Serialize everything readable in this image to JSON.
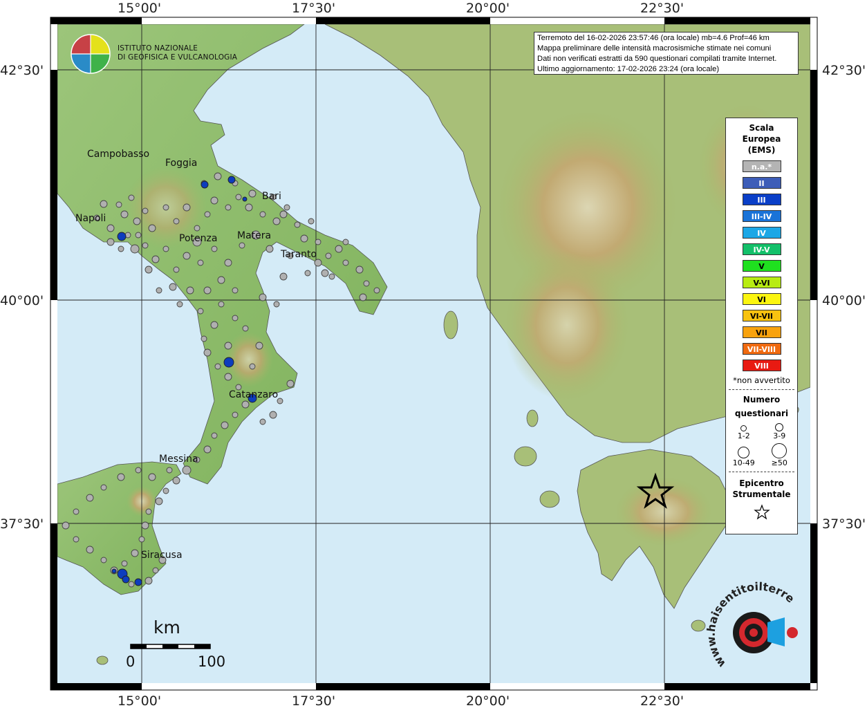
{
  "coords": {
    "top": [
      "15°00'",
      "17°30'",
      "20°00'",
      "22°30'"
    ],
    "bottom": [
      "15°00'",
      "17°30'",
      "20°00'",
      "22°30'"
    ],
    "left": [
      "42°30'",
      "40°00'",
      "37°30'"
    ],
    "right": [
      "42°30'",
      "40°00'",
      "37°30'"
    ]
  },
  "info": {
    "line1": "Terremoto del 16-02-2026 23:57:46 (ora locale) mb=4.6 Prof=46 km",
    "line2": "Mappa preliminare delle intensità macrosismiche stimate nei comuni",
    "line3": "Dati non verificati estratti da 590 questionari compilati tramite Internet.",
    "line4": "Ultimo aggiornamento: 17-02-2026 23:24 (ora locale)"
  },
  "logo": {
    "line1": "ISTITUTO NAZIONALE",
    "line2": "DI GEOFISICA E VULCANOLOGIA"
  },
  "legend": {
    "title1": "Scala",
    "title2": "Europea",
    "title3": "(EMS)",
    "ems": [
      {
        "label": "n.a.*",
        "color": "#b4b4b4"
      },
      {
        "label": "II",
        "color": "#3d5db8"
      },
      {
        "label": "III",
        "color": "#0a3fc8"
      },
      {
        "label": "III-IV",
        "color": "#1a73d8"
      },
      {
        "label": "IV",
        "color": "#1ca7e6"
      },
      {
        "label": "IV-V",
        "color": "#13c06a"
      },
      {
        "label": "V",
        "color": "#1fe01f"
      },
      {
        "label": "V-VI",
        "color": "#b8ec12"
      },
      {
        "label": "VI",
        "color": "#fbf510"
      },
      {
        "label": "VI-VII",
        "color": "#f8c210"
      },
      {
        "label": "VII",
        "color": "#f8a20e"
      },
      {
        "label": "VII-VIII",
        "color": "#f06a10"
      },
      {
        "label": "VIII",
        "color": "#e81a12"
      }
    ],
    "note": "*non avvertito",
    "count_title1": "Numero",
    "count_title2": "questionari",
    "sizes": [
      "1-2",
      "3-9",
      "10-49",
      "≥50"
    ],
    "epi_title1": "Epicentro",
    "epi_title2": "Strumentale"
  },
  "cities": [
    "Campobasso",
    "Foggia",
    "Bari",
    "Napoli",
    "Potenza",
    "Matera",
    "Taranto",
    "Catanzaro",
    "Messina",
    "Siracusa"
  ],
  "scale": {
    "unit": "km",
    "min": "0",
    "max": "100"
  },
  "watermark": {
    "text": "www.haisentitoilterremoto.it"
  },
  "colors": {
    "sea": "#d4ebf7",
    "land": "#8fbf6a",
    "highland": "#c8a86a",
    "grid": "#222222",
    "na_point": "#b0b0b0",
    "blue_point": "#0d3dbd"
  }
}
